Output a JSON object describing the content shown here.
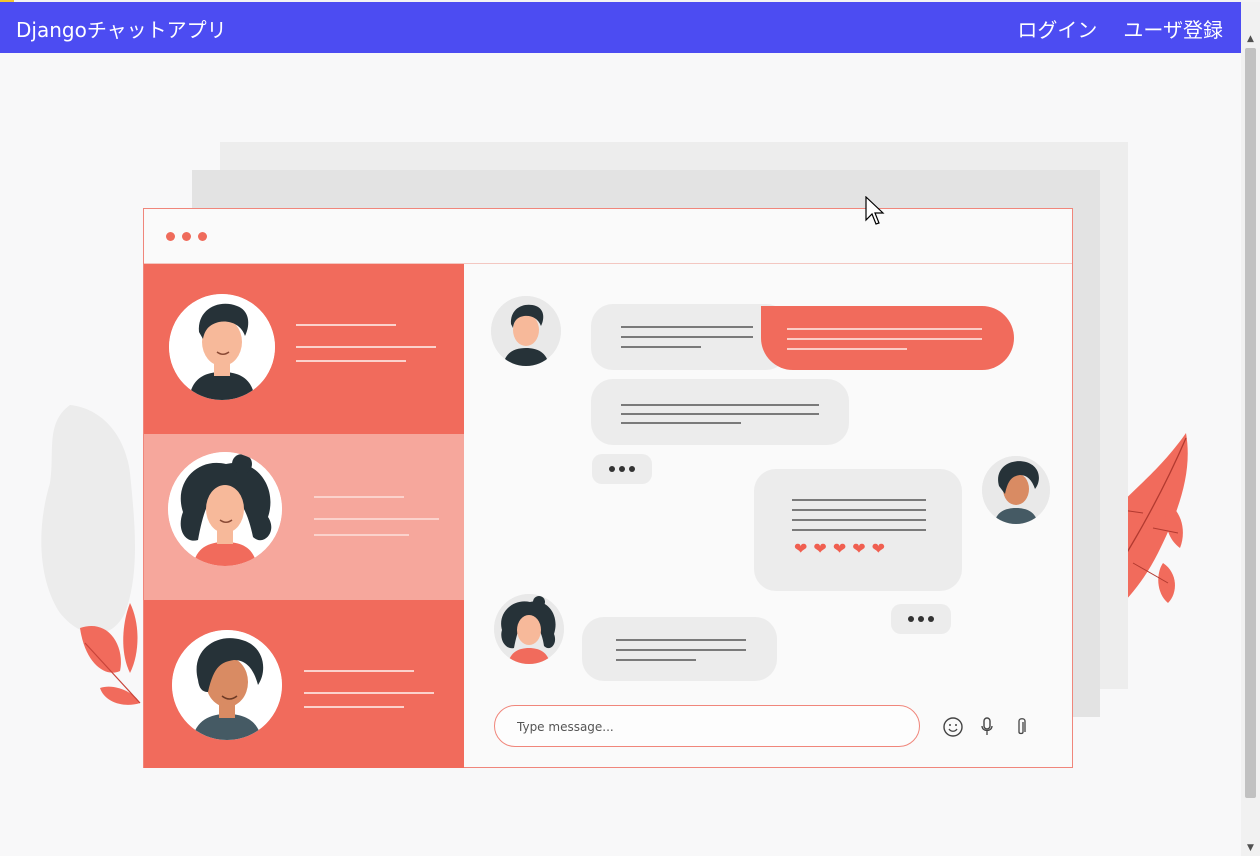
{
  "navbar": {
    "brand": "Djangoチャットアプリ",
    "links": [
      "ログイン",
      "ユーザ登録"
    ],
    "color": "#4c4cf2"
  },
  "illustration": {
    "accent_color": "#f16b5c",
    "input_placeholder": "Type message...",
    "tool_icons": [
      "emoji-icon",
      "microphone-icon",
      "paperclip-icon"
    ],
    "hearts": [
      "❤",
      "❤",
      "❤",
      "❤",
      "❤"
    ]
  }
}
